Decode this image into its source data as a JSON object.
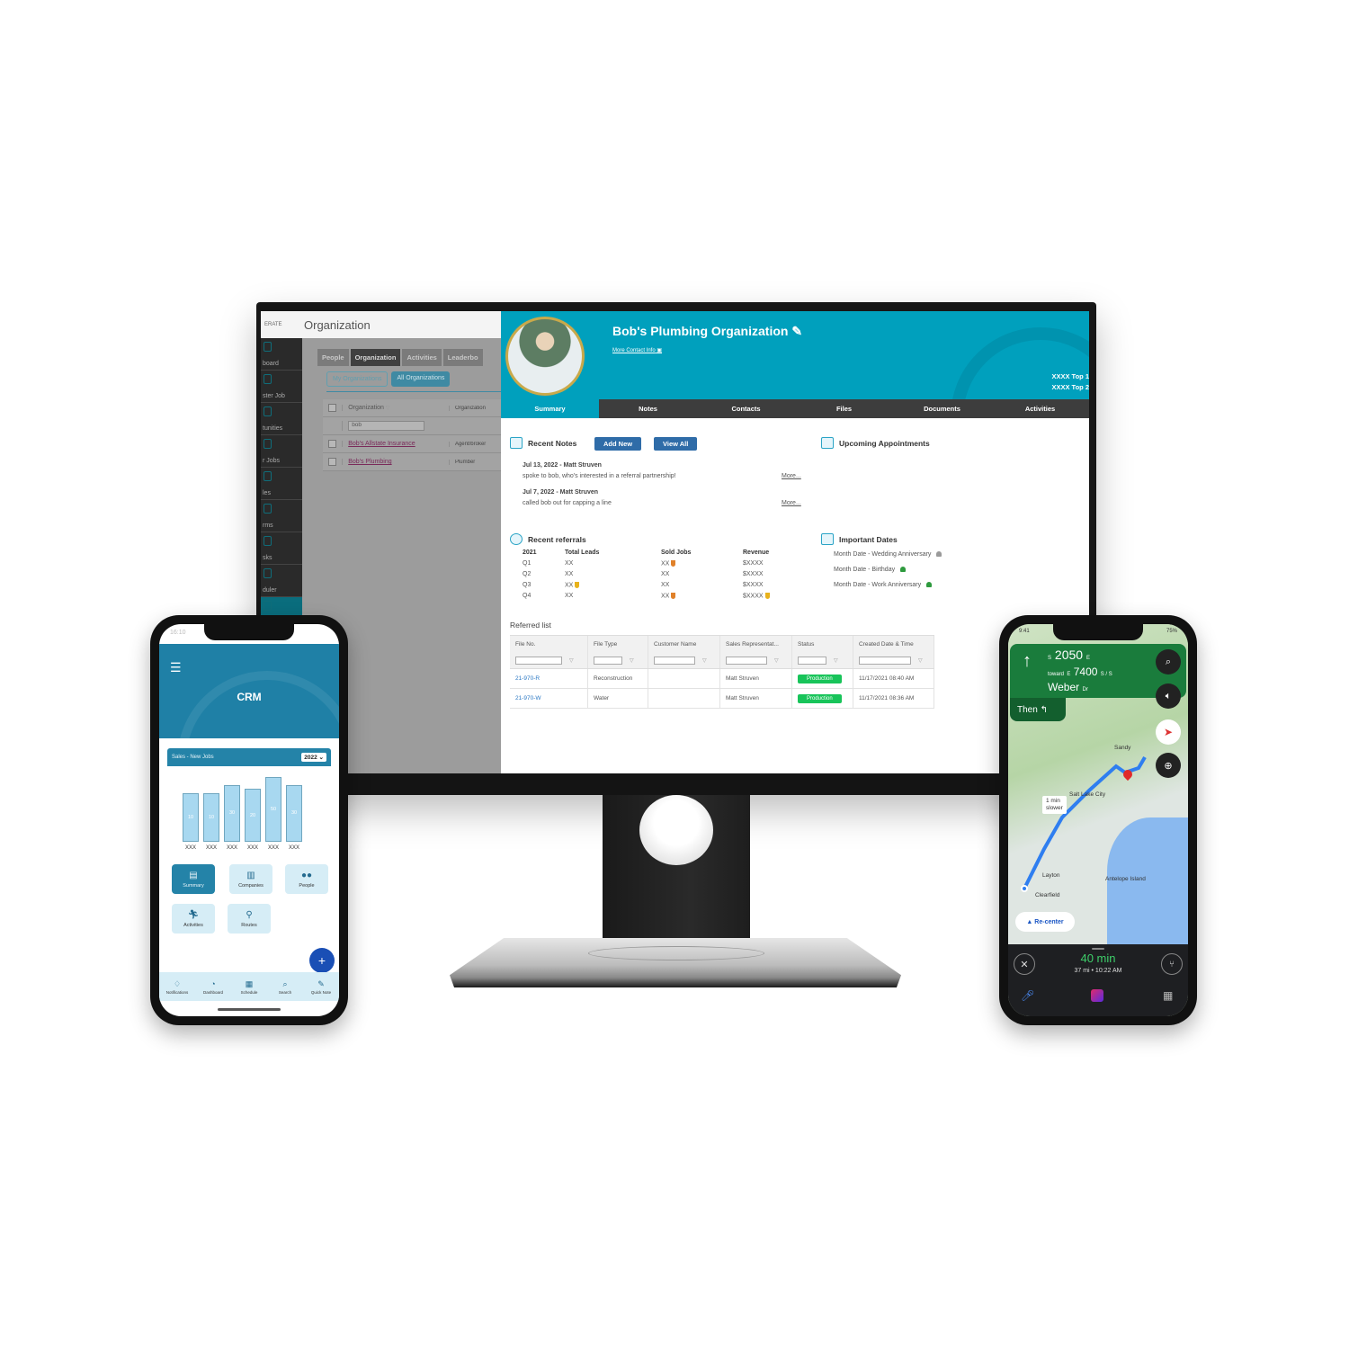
{
  "monitor": {
    "bg_app": {
      "logo": "ERATE",
      "title": "Organization",
      "sidebar": [
        "board",
        "ster Job",
        "tunities",
        "r Jobs",
        "les",
        "rms",
        "sks",
        "duler"
      ],
      "tabs": [
        "People",
        "Organization",
        "Activities",
        "Leaderbo"
      ],
      "active_tab": "Organization",
      "subtabs": [
        "My Organizations",
        "All Organizations"
      ],
      "grid_headers": [
        "Organization",
        "Organization"
      ],
      "filter_value": "bob",
      "rows": [
        {
          "name": "Bob's Allstate Insurance",
          "type": "Agent/broker"
        },
        {
          "name": "Bob's Plumbing",
          "type": "Plumber"
        }
      ]
    },
    "org": {
      "title": "Bob's Plumbing Organization",
      "more_contact": "More Contact Info",
      "top_lines": [
        "XXXX Top 1",
        "XXXX Top 2"
      ],
      "tabs": [
        "Summary",
        "Notes",
        "Contacts",
        "Files",
        "Documents",
        "Activities"
      ],
      "active_tab": "Summary",
      "recent_notes": {
        "title": "Recent Notes",
        "add_new": "Add New",
        "view_all": "View All",
        "notes": [
          {
            "head": "Jul 13, 2022 - Matt Struven",
            "body": "spoke to bob, who's interested in a referral partnership!",
            "more": "More..."
          },
          {
            "head": "Jul 7, 2022 - Matt Struven",
            "body": "called bob out for capping a line",
            "more": "More..."
          }
        ]
      },
      "upcoming_appointments": {
        "title": "Upcoming Appointments"
      },
      "recent_referrals": {
        "title": "Recent referrals",
        "headers": [
          "2021",
          "Total Leads",
          "Sold Jobs",
          "Revenue"
        ],
        "rows": [
          [
            "Q1",
            "XX",
            "XX",
            "$XXXX"
          ],
          [
            "Q2",
            "XX",
            "XX",
            "$XXXX"
          ],
          [
            "Q3",
            "XX",
            "XX",
            "$XXXX"
          ],
          [
            "Q4",
            "XX",
            "XX",
            "$XXXX"
          ]
        ]
      },
      "important_dates": {
        "title": "Important Dates",
        "items": [
          {
            "text": "Month Date - Wedding Anniversary",
            "bell_color": "#9a9a9a"
          },
          {
            "text": "Month Date - Birthday",
            "bell_color": "#2e9a3e"
          },
          {
            "text": "Month Date - Work Anniversary",
            "bell_color": "#2e9a3e"
          }
        ]
      },
      "referred_list": {
        "title": "Referred list",
        "headers": [
          "File No.",
          "File Type",
          "Customer Name",
          "Sales Representat...",
          "Status",
          "Created Date & Time"
        ],
        "rows": [
          [
            "21-970-R",
            "Reconstruction",
            "",
            "Matt Struven",
            "Production",
            "11/17/2021 08:40 AM"
          ],
          [
            "21-970-W",
            "Water",
            "",
            "Matt Struven",
            "Production",
            "11/17/2021 08:36 AM"
          ]
        ]
      }
    }
  },
  "left_phone": {
    "status_time": "16:10",
    "title": "CRM",
    "card_title": "Sales - New Jobs",
    "year": "2022",
    "tiles": [
      "Summary",
      "Companies",
      "People",
      "Activities",
      "Routes"
    ],
    "nav": [
      "Notifications",
      "Dashboard",
      "Schedule",
      "Search",
      "Quick Note"
    ],
    "fab": "+"
  },
  "right_phone": {
    "status_left": "9:41",
    "status_right": "75%",
    "nav_dir": "S",
    "nav_street1": "2050",
    "nav_dir1b": "E",
    "toward": "toward",
    "nav_dir2": "E",
    "nav_street2": "7400",
    "nav_dir2b": "S / S",
    "nav_street3": "Weber",
    "nav_dir3": "Dr",
    "then": "Then",
    "map_labels": [
      "Sandy",
      "Salt Lake City",
      "Layton",
      "Clearfield",
      "Antelope Island"
    ],
    "slower_tip": [
      "1 min",
      "slower"
    ],
    "recenter": "Re-center",
    "eta": "40 min",
    "eta_sub": "37 mi  •  10:22 AM"
  },
  "chart_data": {
    "type": "bar",
    "title": "Sales - New Jobs",
    "categories": [
      "XXX",
      "XXX",
      "XXX",
      "XXX",
      "XXX",
      "XXX"
    ],
    "values": [
      10,
      10,
      30,
      20,
      50,
      30
    ],
    "xlabel": "",
    "ylabel": "",
    "ylim": [
      0,
      50
    ]
  }
}
